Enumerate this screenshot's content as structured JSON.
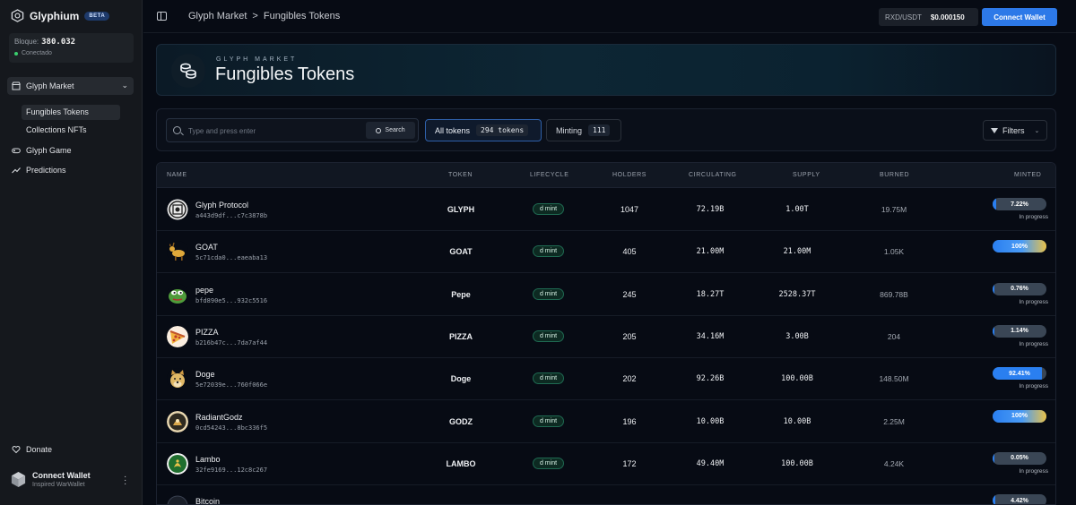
{
  "sidebar": {
    "brand": "Glyphium",
    "beta": "BETA",
    "block_label": "Bloque:",
    "block_value": "380.032",
    "status": "Conectado",
    "nav": {
      "market": "Glyph Market",
      "fungibles": "Fungibles Tokens",
      "collections": "Collections NFTs",
      "game": "Glyph Game",
      "predictions": "Predictions"
    },
    "donate": "Donate",
    "wallet_title": "Connect Wallet",
    "wallet_sub": "Inspired WarWallet"
  },
  "topbar": {
    "crumb_root": "Glyph Market",
    "crumb_sep": ">",
    "crumb_current": "Fungibles Tokens",
    "price_pair": "RXD/USDT",
    "price_value": "$0.000150",
    "connect": "Connect Wallet"
  },
  "hero": {
    "supertitle": "GLYPH MARKET",
    "title": "Fungibles Tokens"
  },
  "filters": {
    "search_placeholder": "Type and press enter",
    "search_button": "Search",
    "tab_all": "All tokens",
    "tab_all_count": "294 tokens",
    "tab_minting": "Minting",
    "tab_minting_count": "111",
    "filters_button": "Filters"
  },
  "table": {
    "columns": [
      "NAME",
      "TOKEN",
      "LIFECYCLE",
      "HOLDERS",
      "CIRCULATING",
      "SUPPLY",
      "BURNED",
      "MINTED"
    ],
    "rows": [
      {
        "name": "Glyph Protocol",
        "addr": "a443d9df...c7c3878b",
        "ticker": "GLYPH",
        "lifecycle": "d mint",
        "holders": "1047",
        "circulating": "72.19B",
        "supply": "1.00T",
        "burned": "19.75M",
        "minted_label": "7.22%",
        "minted": 7.22,
        "status": "In progress",
        "avatar": "glyph-logo"
      },
      {
        "name": "GOAT",
        "addr": "5c71cda0...eaeaba13",
        "ticker": "GOAT",
        "lifecycle": "d mint",
        "holders": "405",
        "circulating": "21.00M",
        "supply": "21.00M",
        "burned": "1.05K",
        "minted_label": "100%",
        "minted": 100,
        "status": "",
        "avatar": "goat"
      },
      {
        "name": "pepe",
        "addr": "bfd890e5...932c5516",
        "ticker": "Pepe",
        "lifecycle": "d mint",
        "holders": "245",
        "circulating": "18.27T",
        "supply": "2528.37T",
        "burned": "869.78B",
        "minted_label": "0.76%",
        "minted": 0.76,
        "status": "In progress",
        "avatar": "pepe"
      },
      {
        "name": "PIZZA",
        "addr": "b216b47c...7da7af44",
        "ticker": "PIZZA",
        "lifecycle": "d mint",
        "holders": "205",
        "circulating": "34.16M",
        "supply": "3.00B",
        "burned": "204",
        "minted_label": "1.14%",
        "minted": 1.14,
        "status": "In progress",
        "avatar": "pizza"
      },
      {
        "name": "Doge",
        "addr": "5e72039e...760f066e",
        "ticker": "Doge",
        "lifecycle": "d mint",
        "holders": "202",
        "circulating": "92.26B",
        "supply": "100.00B",
        "burned": "148.50M",
        "minted_label": "92.41%",
        "minted": 92.41,
        "status": "In progress",
        "avatar": "doge"
      },
      {
        "name": "RadiantGodz",
        "addr": "0cd54243...8bc336f5",
        "ticker": "GODZ",
        "lifecycle": "d mint",
        "holders": "196",
        "circulating": "10.00B",
        "supply": "10.00B",
        "burned": "2.25M",
        "minted_label": "100%",
        "minted": 100,
        "status": "",
        "avatar": "godz"
      },
      {
        "name": "Lambo",
        "addr": "32fe9169...12c8c267",
        "ticker": "LAMBO",
        "lifecycle": "d mint",
        "holders": "172",
        "circulating": "49.40M",
        "supply": "100.00B",
        "burned": "4.24K",
        "minted_label": "0.05%",
        "minted": 0.05,
        "status": "In progress",
        "avatar": "lambo"
      },
      {
        "name": "Bitcoin",
        "addr": "",
        "ticker": "",
        "lifecycle": "",
        "holders": "",
        "circulating": "",
        "supply": "",
        "burned": "",
        "minted_label": "4.42%",
        "minted": 4.42,
        "status": "",
        "avatar": "bitcoin"
      }
    ]
  }
}
